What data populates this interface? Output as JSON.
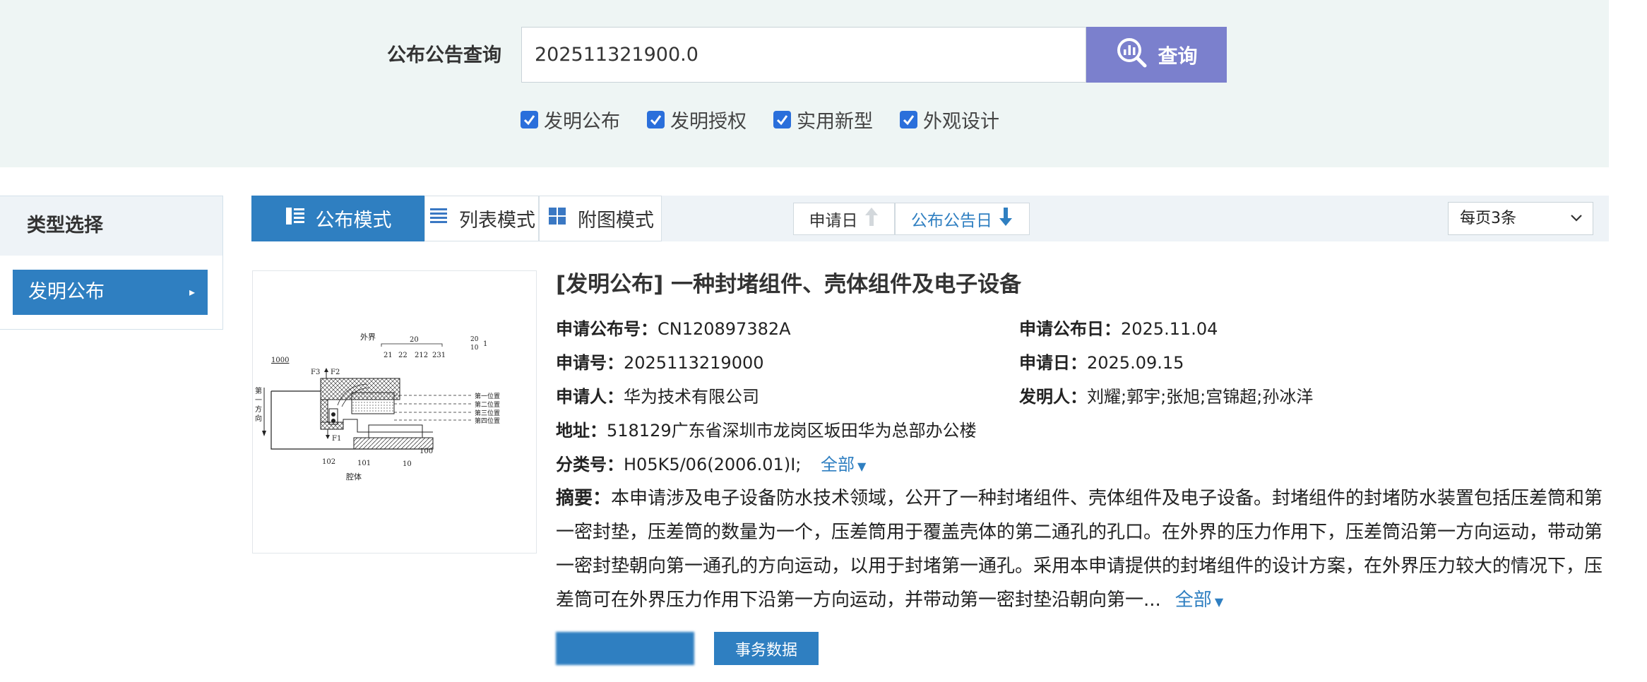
{
  "search": {
    "label": "公布公告查询",
    "value": "202511321900.0",
    "button_label": "查询",
    "checkboxes": [
      {
        "label": "发明公布",
        "checked": true
      },
      {
        "label": "发明授权",
        "checked": true
      },
      {
        "label": "实用新型",
        "checked": true
      },
      {
        "label": "外观设计",
        "checked": true
      }
    ]
  },
  "sidebar": {
    "title": "类型选择",
    "items": [
      {
        "label": "发明公布",
        "active": true
      }
    ]
  },
  "toolbar": {
    "modes": [
      {
        "label": "公布模式",
        "icon": "publish-mode-icon",
        "active": true
      },
      {
        "label": "列表模式",
        "icon": "list-icon",
        "active": false
      },
      {
        "label": "附图模式",
        "icon": "grid-icon",
        "active": false
      }
    ],
    "sorts": [
      {
        "label": "申请日",
        "direction": "up",
        "active": false
      },
      {
        "label": "公布公告日",
        "direction": "down",
        "active": true
      }
    ],
    "per_page": "每页3条"
  },
  "result": {
    "title": "[发明公布] 一种封堵组件、壳体组件及电子设备",
    "pub_no_label": "申请公布号：",
    "pub_no": "CN120897382A",
    "pub_date_label": "申请公布日：",
    "pub_date": "2025.11.04",
    "app_no_label": "申请号：",
    "app_no": "2025113219000",
    "app_date_label": "申请日：",
    "app_date": "2025.09.15",
    "applicant_label": "申请人：",
    "applicant": "华为技术有限公司",
    "inventor_label": "发明人：",
    "inventors": "刘耀;郭宇;张旭;宫锦超;孙冰洋",
    "address_label": "地址：",
    "address": "518129广东省深圳市龙岗区坂田华为总部办公楼",
    "class_label": "分类号：",
    "class": "H05K5/06(2006.01)I;",
    "more": "全部",
    "abstract_label": "摘要：",
    "abstract_lines": [
      "本申请涉及电子设备防水技术领域，公开了一种封堵组件、壳体组件及电子设备。封堵组件的封堵防水装置包括压差筒和第",
      "一密封垫，压差筒的数量为一个，压差筒用于覆盖壳体的第二通孔的孔口。在外界的压力作用下，压差筒沿第一方向运动，带动第",
      "一密封垫朝向第一通孔的方向运动，以用于封堵第一通孔。采用本申请提供的封堵组件的设计方案，在外界压力较大的情况下，压",
      "差筒可在外界压力作用下沿第一方向运动，并带动第一密封垫沿朝向第一..."
    ],
    "abstract_more": "全部",
    "buttons": [
      "",
      "事务数据"
    ],
    "figure_labels": {
      "outer": "外界",
      "ref1000": "1000",
      "ref20": "20",
      "ref21": "21",
      "ref22": "22",
      "ref212": "212",
      "ref231": "231",
      "ref20b": "20",
      "ref10b": "10",
      "ref1": "1",
      "F3": "F3",
      "F2": "F2",
      "F1": "F1",
      "dir": [
        "第",
        "一",
        "方",
        "向"
      ],
      "pos1": "第一位置",
      "pos2": "第二位置",
      "pos3": "第三位置",
      "pos4": "第四位置",
      "ref100": "100",
      "ref102": "102",
      "ref101": "101",
      "ref10": "10",
      "cavity": "腔体"
    }
  }
}
